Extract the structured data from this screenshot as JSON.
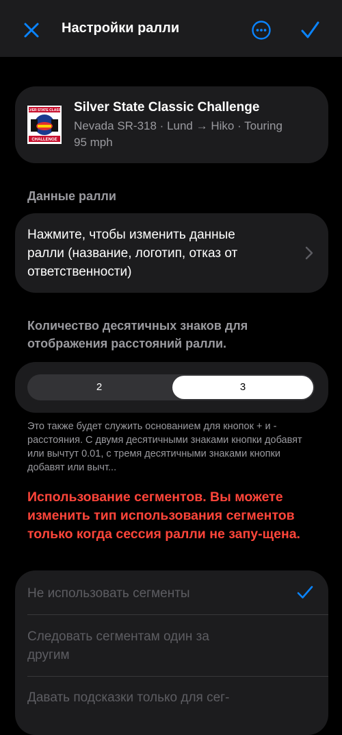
{
  "header": {
    "title": "Настройки ралли",
    "close_icon": "close-x-icon",
    "more_icon": "ellipsis-circle-icon",
    "done_icon": "checkmark-icon",
    "accent_color": "#0a84ff"
  },
  "rally": {
    "name": "Silver State Classic Challenge",
    "route": "Nevada SR-318 · Lund → Hiko · Touring",
    "speed": "95 mph",
    "logo_text_top": "SILVER STATE CLASSIC",
    "logo_text_bottom": "CHALLENGE"
  },
  "rally_data": {
    "header": "Данные ралли",
    "edit_label": "Нажмите, чтобы изменить данные ралли (название, логотип, отказ от ответственности)"
  },
  "decimals": {
    "header": "Количество десятичных знаков для отображения расстояний ралли.",
    "options": [
      "2",
      "3"
    ],
    "selected": "3",
    "footnote": "Это также будет служить основанием для кнопок + и - расстояния. С двумя десятичными знаками кнопки добавят или вычтут 0.01, с тремя десятичными знаками кнопки добавят или вычт..."
  },
  "segments": {
    "warning": "Использование сегментов. Вы можете изменить тип использования сегментов только когда сессия ралли не запу-щена.",
    "options": [
      "Не использовать сегменты",
      "Следовать сегментам один за другим",
      "Давать подсказки только для сег-"
    ],
    "selected": "Не использовать сегменты"
  }
}
